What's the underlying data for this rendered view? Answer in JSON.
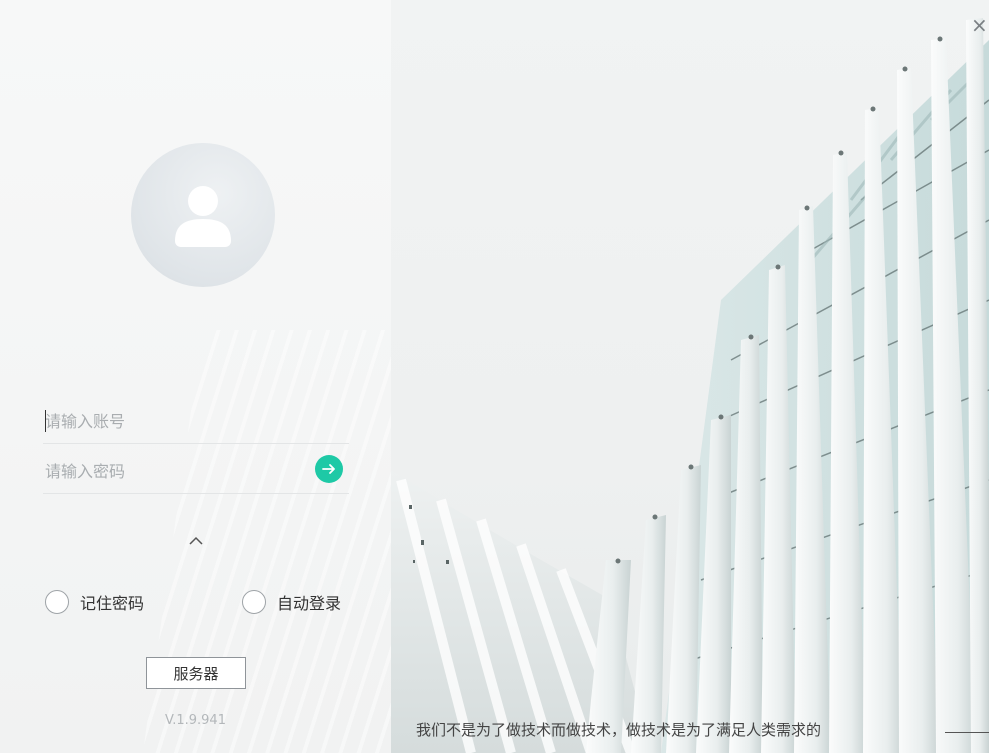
{
  "login": {
    "account_placeholder": "请输入账号",
    "password_placeholder": "请输入密码",
    "remember_password_label": "记住密码",
    "auto_login_label": "自动登录",
    "server_button_label": "服务器",
    "version": "V.1.9.941"
  },
  "banner": {
    "close_symbol": "×",
    "slogan": "我们不是为了做技术而做技术，做技术是为了满足人类需求的"
  },
  "icons": {
    "avatar": "user-silhouette-icon",
    "submit": "arrow-right-icon",
    "collapse": "chevron-up-icon",
    "close": "close-icon"
  },
  "colors": {
    "accent": "#1ec9a6",
    "avatar_bg": "#dfe4e8",
    "panel_bg": "#f5f6f6"
  }
}
